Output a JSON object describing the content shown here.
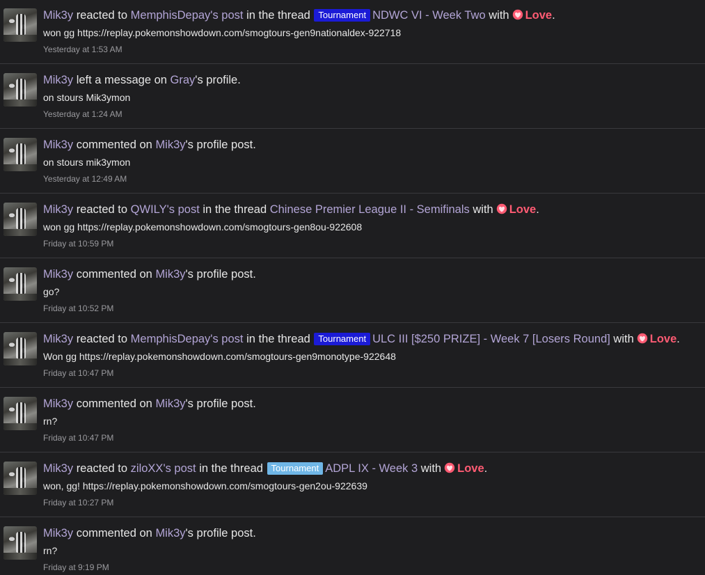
{
  "items": [
    {
      "actor": "Mik3y",
      "verb": "reacted to",
      "target": "MemphisDepay's post",
      "in_thread_text": "in the thread",
      "badge": "Tournament",
      "thread": "NDWC VI - Week Two",
      "with_text": "with",
      "reaction": "Love",
      "snippet": "won gg https://replay.pokemonshowdown.com/smogtours-gen9nationaldex-922718",
      "time": "Yesterday at 1:53 AM"
    },
    {
      "actor": "Mik3y",
      "verb": "left a message on",
      "target": "Gray",
      "suffix": "'s profile.",
      "snippet": "on stours Mik3ymon",
      "time": "Yesterday at 1:24 AM"
    },
    {
      "actor": "Mik3y",
      "verb": "commented on",
      "target": "Mik3y",
      "suffix": "'s profile post.",
      "snippet": "on stours mik3ymon",
      "time": "Yesterday at 12:49 AM"
    },
    {
      "actor": "Mik3y",
      "verb": "reacted to",
      "target": "QWILY's post",
      "in_thread_text": "in the thread",
      "thread": "Chinese Premier League II - Semifinals",
      "with_text": "with",
      "reaction": "Love",
      "snippet": "won gg https://replay.pokemonshowdown.com/smogtours-gen8ou-922608",
      "time": "Friday at 10:59 PM"
    },
    {
      "actor": "Mik3y",
      "verb": "commented on",
      "target": "Mik3y",
      "suffix": "'s profile post.",
      "snippet": "go?",
      "time": "Friday at 10:52 PM"
    },
    {
      "actor": "Mik3y",
      "verb": "reacted to",
      "target": "MemphisDepay's post",
      "in_thread_text": "in the thread",
      "badge": "Tournament",
      "thread": "ULC III [$250 PRIZE] - Week 7 [Losers Round]",
      "with_text": "with",
      "reaction": "Love",
      "snippet": "Won gg https://replay.pokemonshowdown.com/smogtours-gen9monotype-922648",
      "time": "Friday at 10:47 PM"
    },
    {
      "actor": "Mik3y",
      "verb": "commented on",
      "target": "Mik3y",
      "suffix": "'s profile post.",
      "snippet": "rn?",
      "time": "Friday at 10:47 PM"
    },
    {
      "actor": "Mik3y",
      "verb": "reacted to",
      "target": "ziloXX's post",
      "in_thread_text": "in the thread",
      "badge": "Tournament",
      "thread": "ADPL IX - Week 3",
      "with_text": "with",
      "reaction": "Love",
      "snippet": "won, gg! https://replay.pokemonshowdown.com/smogtours-gen2ou-922639",
      "time": "Friday at 10:27 PM"
    },
    {
      "actor": "Mik3y",
      "verb": "commented on",
      "target": "Mik3y",
      "suffix": "'s profile post.",
      "snippet": "rn?",
      "time": "Friday at 9:19 PM"
    }
  ],
  "period": ".",
  "colors": {
    "background": "#1e1e20",
    "link": "#b3a5d6",
    "love": "#ff5b73",
    "badge_dark_blue": "#1b1bd6",
    "badge_light_blue": "#6fb6e6",
    "divider": "#3a3a3d"
  },
  "icons": {
    "reaction": "heart-love-icon",
    "avatar": "user-avatar"
  }
}
